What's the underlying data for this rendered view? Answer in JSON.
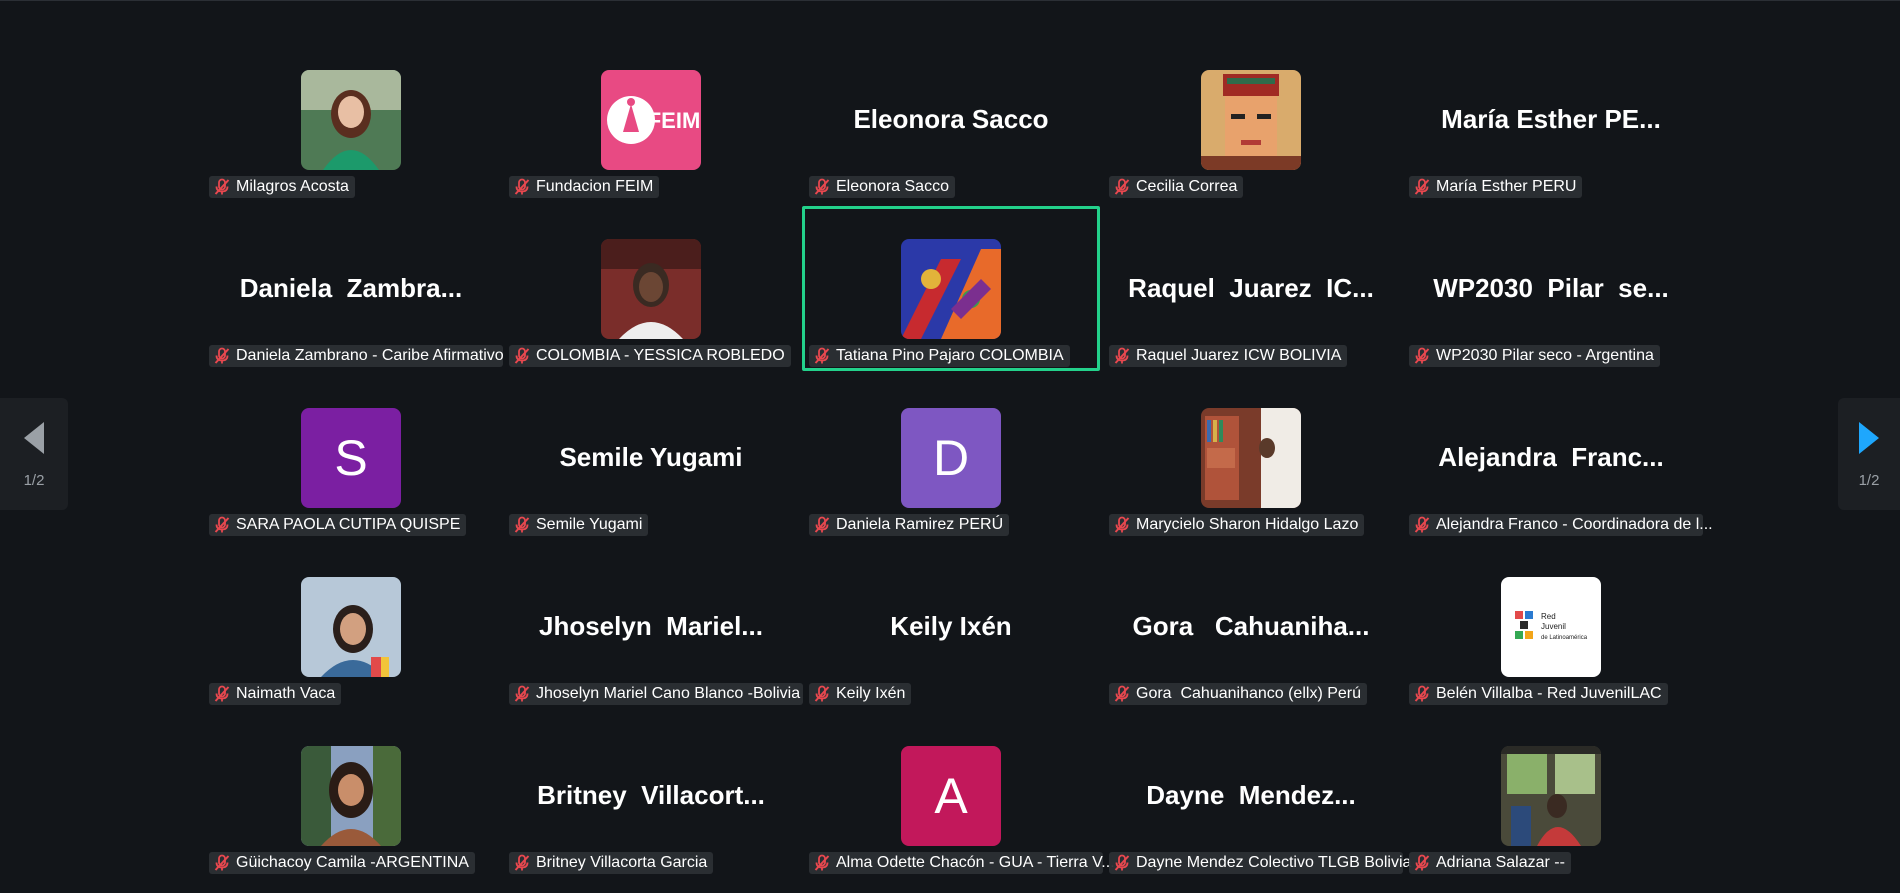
{
  "participants": [
    {
      "name": "Milagros Acosta",
      "tile_text": "",
      "avatar": "photo-woman-green"
    },
    {
      "name": "Fundacion FEIM",
      "tile_text": "",
      "avatar": "feim-logo"
    },
    {
      "name": "Eleonora Sacco",
      "tile_text": "Eleonora Sacco",
      "avatar": ""
    },
    {
      "name": "Cecilia Correa",
      "tile_text": "",
      "avatar": "frida-illustration"
    },
    {
      "name": "María Esther PERU",
      "tile_text": "María Esther PE...",
      "avatar": ""
    },
    {
      "name": "Daniela Zambrano - Caribe Afirmativo",
      "tile_text": "Daniela  Zambra...",
      "avatar": ""
    },
    {
      "name": "COLOMBIA - YESSICA ROBLEDO",
      "tile_text": "",
      "avatar": "photo-woman-glasses"
    },
    {
      "name": "Tatiana Pino Pajaro COLOMBIA",
      "tile_text": "",
      "avatar": "colorful-art"
    },
    {
      "name": "Raquel Juarez ICW BOLIVIA",
      "tile_text": "Raquel  Juarez  IC...",
      "avatar": ""
    },
    {
      "name": "WP2030 Pilar seco - Argentina",
      "tile_text": "WP2030  Pilar  se...",
      "avatar": ""
    },
    {
      "name": "SARA PAOLA CUTIPA QUISPE",
      "tile_text": "",
      "avatar": "letter",
      "letter": "S",
      "color": "#7b1fa2"
    },
    {
      "name": "Semile Yugami",
      "tile_text": "Semile Yugami",
      "avatar": ""
    },
    {
      "name": "Daniela Ramirez PERÚ",
      "tile_text": "",
      "avatar": "letter",
      "letter": "D",
      "color": "#7e57c2"
    },
    {
      "name": "Marycielo Sharon Hidalgo Lazo",
      "tile_text": "",
      "avatar": "photo-bookshelf"
    },
    {
      "name": "Alejandra Franco - Coordinadora de l...",
      "tile_text": "Alejandra  Franc...",
      "avatar": ""
    },
    {
      "name": "Naimath Vaca",
      "tile_text": "",
      "avatar": "photo-woman-sky"
    },
    {
      "name": "Jhoselyn Mariel Cano Blanco -Bolivia",
      "tile_text": "Jhoselyn  Mariel...",
      "avatar": ""
    },
    {
      "name": "Keily Ixén",
      "tile_text": "Keily Ixén",
      "avatar": ""
    },
    {
      "name": "Gora  Cahuanihanco (ellx) Perú",
      "tile_text": "Gora   Cahuaniha...",
      "avatar": ""
    },
    {
      "name": "Belén Villalba - Red JuvenilLAC",
      "tile_text": "",
      "avatar": "red-juvenil-logo",
      "logo_text": "Red\nJuvenil\nde Latinoamérica"
    },
    {
      "name": "Güichacoy Camila -ARGENTINA",
      "tile_text": "",
      "avatar": "photo-woman-trees"
    },
    {
      "name": "Britney Villacorta Garcia",
      "tile_text": "Britney  Villacort...",
      "avatar": ""
    },
    {
      "name": "Alma Odette Chacón - GUA - Tierra V...",
      "tile_text": "",
      "avatar": "letter",
      "letter": "A",
      "color": "#c2185b"
    },
    {
      "name": "Dayne Mendez Colectivo TLGB Bolivia",
      "tile_text": "Dayne  Mendez...",
      "avatar": ""
    },
    {
      "name": "Adriana Salazar --",
      "tile_text": "",
      "avatar": "photo-train"
    }
  ],
  "active_index": 7,
  "feim_text": "FEIM",
  "pager": {
    "left": "1/2",
    "right": "1/2"
  },
  "colors": {
    "active_border": "#23d18b",
    "arrow_right": "#1ea7fd",
    "arrow_left": "#9aa0a6",
    "mute": "#e8484f"
  }
}
